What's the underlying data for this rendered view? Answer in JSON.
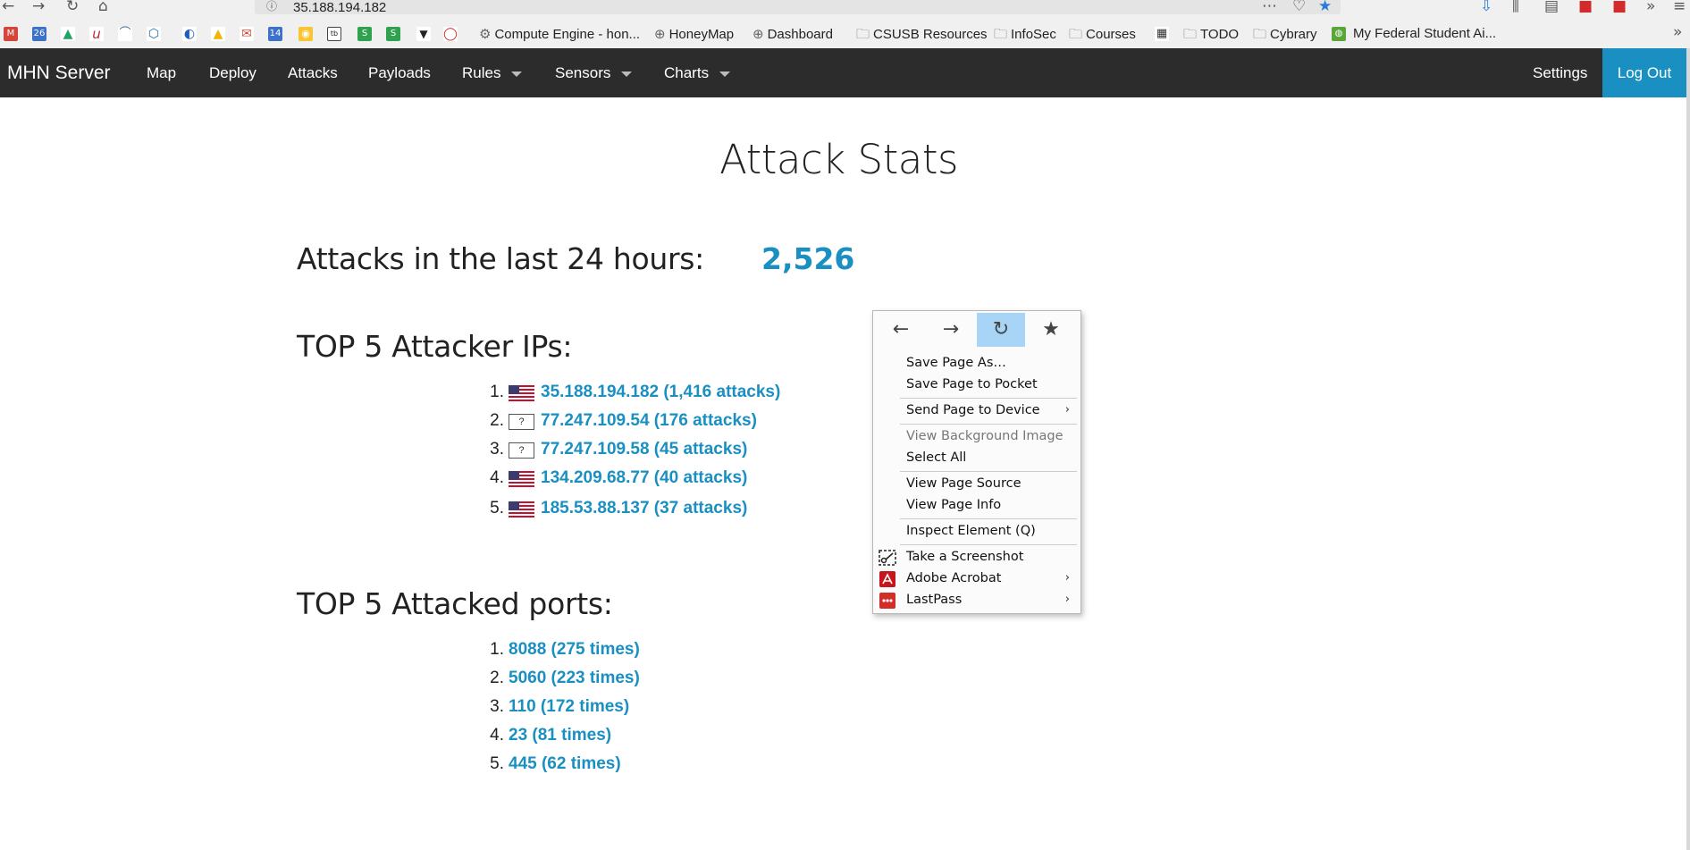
{
  "browser": {
    "url": "35.188.194.182",
    "bookmarks": [
      "Compute Engine - hon...",
      "HoneyMap",
      "Dashboard",
      "CSUSB Resources",
      "InfoSec",
      "Courses",
      "TODO",
      "Cybrary",
      "My Federal Student Ai..."
    ],
    "favicon_labels": [
      "26",
      "u",
      "14",
      "tb"
    ]
  },
  "navbar": {
    "brand": "MHN Server",
    "items": [
      "Map",
      "Deploy",
      "Attacks",
      "Payloads",
      "Rules",
      "Sensors",
      "Charts"
    ],
    "settings": "Settings",
    "logout": "Log Out",
    "accent_color": "#1a8fc1"
  },
  "main": {
    "title": "Attack Stats",
    "attacks_label": "Attacks in the last 24 hours:",
    "attacks_count": "2,526",
    "top_ips_heading": "TOP 5 Attacker IPs:",
    "top_ips": [
      {
        "num": "1.",
        "text": "35.188.194.182 (1,416 attacks)",
        "flag": "us"
      },
      {
        "num": "2.",
        "text": "77.247.109.54 (176 attacks)",
        "flag": "unknown"
      },
      {
        "num": "3.",
        "text": "77.247.109.58 (45 attacks)",
        "flag": "unknown"
      },
      {
        "num": "4.",
        "text": "134.209.68.77 (40 attacks)",
        "flag": "us"
      },
      {
        "num": "5.",
        "text": "185.53.88.137 (37 attacks)",
        "flag": "us"
      }
    ],
    "unknown_flag_mark": "?",
    "top_ports_heading": "TOP 5 Attacked ports:",
    "top_ports": [
      {
        "num": "1.",
        "text": "8088 (275 times)"
      },
      {
        "num": "2.",
        "text": "5060 (223 times)"
      },
      {
        "num": "3.",
        "text": "110 (172 times)"
      },
      {
        "num": "4.",
        "text": "23 (81 times)"
      },
      {
        "num": "5.",
        "text": "445 (62 times)"
      }
    ]
  },
  "context_menu": {
    "items": {
      "save_page_as": "Save Page As…",
      "save_to_pocket": "Save Page to Pocket",
      "send_to_device": "Send Page to Device",
      "view_bg_image": "View Background Image",
      "select_all": "Select All",
      "view_source": "View Page Source",
      "view_info": "View Page Info",
      "inspect": "Inspect Element (Q)",
      "screenshot": "Take a Screenshot",
      "acrobat": "Adobe Acrobat",
      "lastpass": "LastPass"
    },
    "submenu_arrow": "›",
    "hovered_button_color": "#a8d4f5"
  }
}
